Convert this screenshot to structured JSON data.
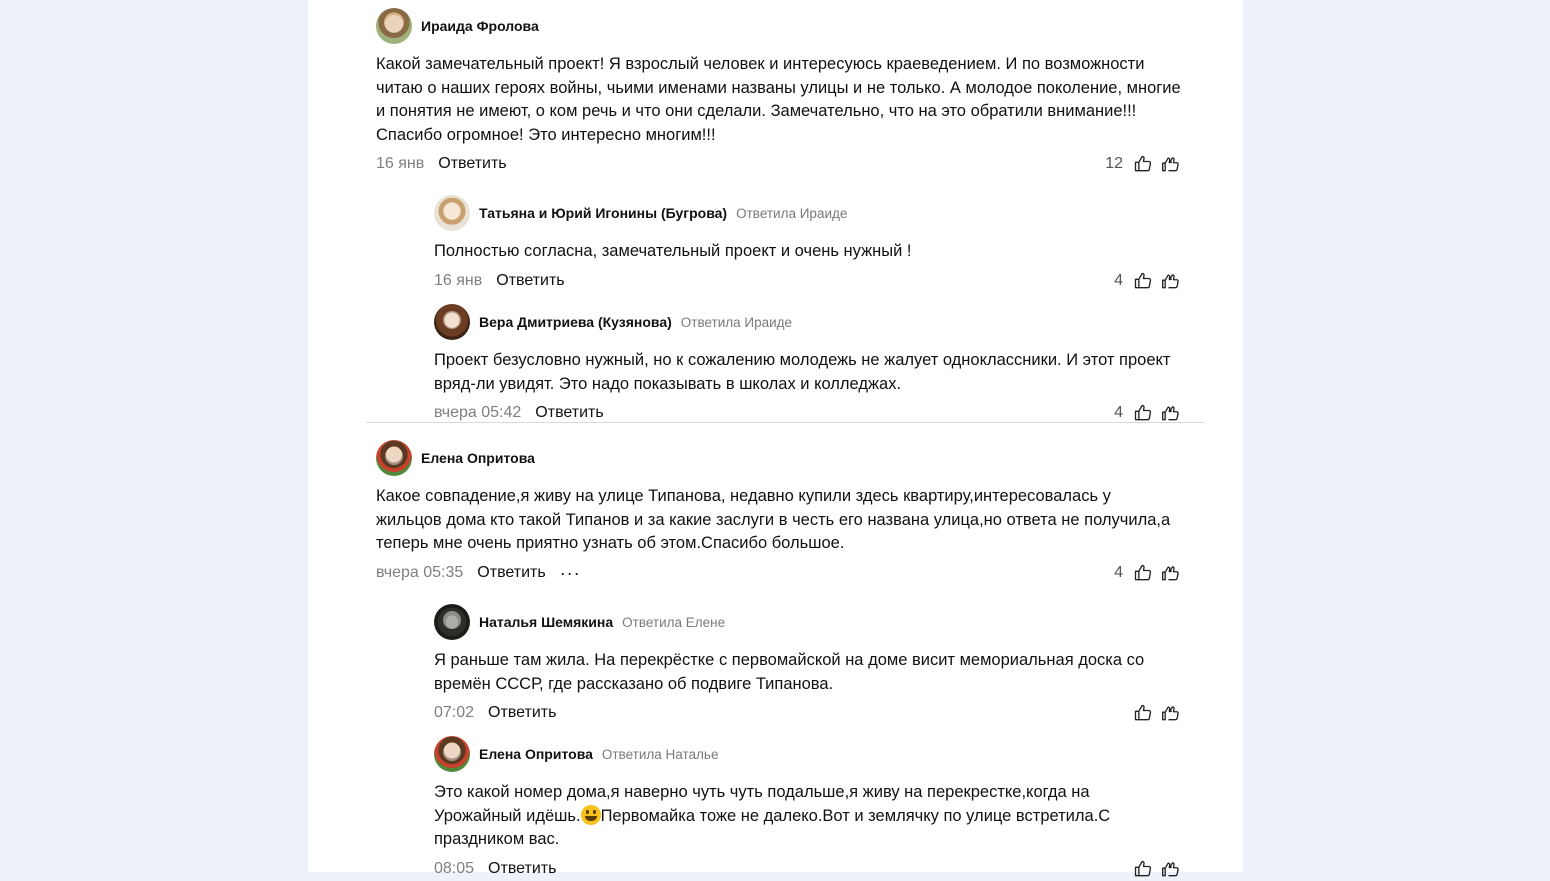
{
  "accent": "#000000",
  "labels": {
    "reply": "Ответить",
    "more": "···"
  },
  "comments": [
    {
      "author": "Ираида Фролова",
      "reply_to": "",
      "text": "Какой замечательный проект! Я взрослый человек и интересуюсь краеведением. И по возможности читаю о наших героях войны, чьими именами названы улицы и не только. А молодое поколение, многие и понятия не имеют, о ком речь и что они сделали. Замечательно, что на это обратили внимание!!! Спасибо огромное! Это интересно многим!!!",
      "time": "16 янв",
      "likes": "12"
    },
    {
      "author": "Татьяна и Юрий Игонины (Бугрова)",
      "reply_to": "Ответила Ираиде",
      "text": "Полностью согласна, замечательный проект и очень нужный !",
      "time": "16 янв",
      "likes": "4"
    },
    {
      "author": "Вера Дмитриева (Кузянова)",
      "reply_to": "Ответила Ираиде",
      "text": "Проект безусловно нужный, но к сожалению молодежь не жалует одноклассники. И этот проект вряд-ли увидят. Это надо показывать в школах и колледжах.",
      "time": "вчера 05:42",
      "likes": "4"
    },
    {
      "author": "Елена Опритова",
      "reply_to": "",
      "text": "Какое совпадение,я живу на улице Типанова, недавно купили здесь квартиру,интересовалась у жильцов дома кто такой Типанов и за какие заслуги в честь его названа улица,но ответа не получила,а теперь мне очень приятно узнать об этом.Спасибо большое.",
      "time": "вчера 05:35",
      "likes": "4"
    },
    {
      "author": "Наталья Шемякина",
      "reply_to": "Ответила Елене",
      "text": "Я раньше там жила. На перекрёстке с первомайской на доме висит мемориальная доска со времён СССР, где рассказано об подвиге Типанова.",
      "time": "07:02",
      "likes": ""
    },
    {
      "author": "Елена Опритова",
      "reply_to": "Ответила Наталье",
      "text_before_emoji": "Это какой номер дома,я наверно чуть чуть подальше,я живу на перекрестке,когда на Урожайный идёшь.",
      "text_after_emoji": "Первомайка тоже не далеко.Вот и землячку по улице встретила.С праздником вас.",
      "emoji": "grinning-face-emoji",
      "time": "08:05",
      "likes": ""
    }
  ]
}
